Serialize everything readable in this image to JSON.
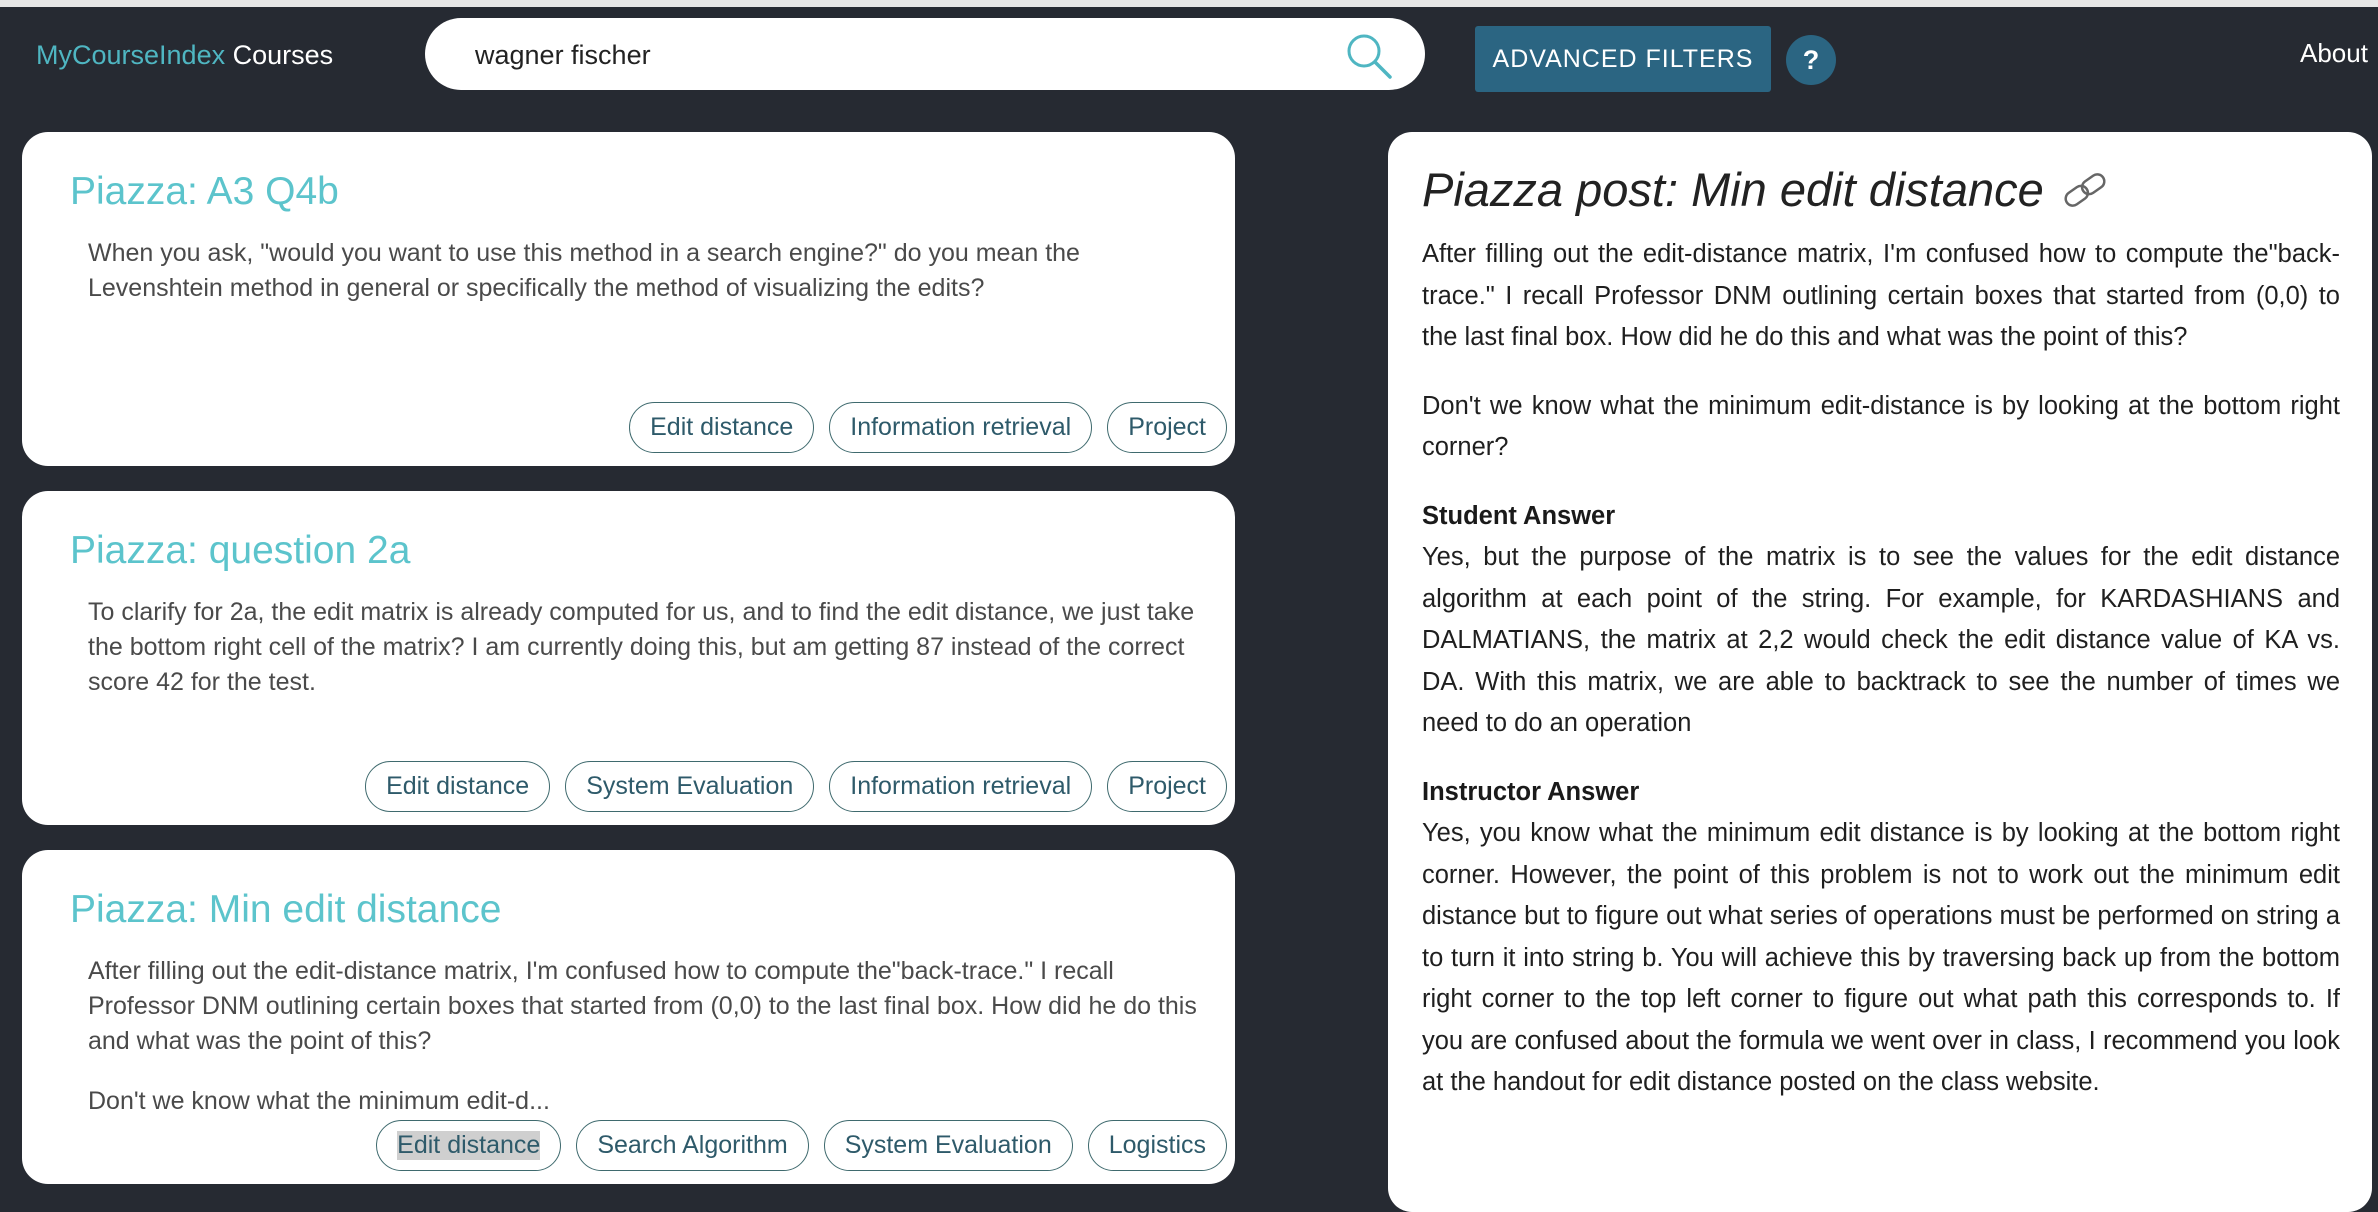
{
  "header": {
    "brand_left": "MyCourseIndex",
    "brand_right": "Courses",
    "search_value": "wagner fischer",
    "advanced_filters_label": "ADVANCED FILTERS",
    "help_label": "?",
    "about_label": "About"
  },
  "results": [
    {
      "title": "Piazza: A3 Q4b",
      "body": "When you ask, \"would you want to use this method in a search engine?\" do you mean the Levenshtein method in general or specifically the method of visualizing the edits?",
      "tags": [
        "Edit distance",
        "Information retrieval",
        "Project"
      ]
    },
    {
      "title": "Piazza: question 2a",
      "body": "To clarify for 2a, the edit matrix is already computed for us, and to find the edit distance, we just take the bottom right cell of the matrix? I am currently doing this, but am getting 87 instead of the correct score 42 for the test.",
      "tags": [
        "Edit distance",
        "System Evaluation",
        "Information retrieval",
        "Project"
      ]
    },
    {
      "title": "Piazza: Min edit distance",
      "body": "After filling out the edit-distance matrix, I'm confused how to compute the\"back-trace.\" I recall Professor DNM outlining certain boxes that started from (0,0) to the last final box. How did he do this and what was the point of this?",
      "body2": "Don't we know what the minimum edit-d...",
      "tags": [
        "Edit distance",
        "Search Algorithm",
        "System Evaluation",
        "Logistics"
      ]
    }
  ],
  "detail": {
    "title": "Piazza post: Min edit distance",
    "link_icon": "link-icon",
    "para1": "After filling out the edit-distance matrix, I'm confused how to compute the\"back-trace.\" I recall Professor DNM outlining certain boxes that started from (0,0) to the last final box. How did he do this and what was the point of this?",
    "para2": "Don't we know what the minimum edit-distance is by looking at the bottom right corner?",
    "student_label": "Student Answer",
    "student_answer": "Yes, but the purpose of the matrix is to see the values for the edit distance algorithm at each point of the string. For example, for KARDASHIANS and DALMATIANS, the matrix at 2,2 would check the edit distance value of KA vs. DA. With this matrix, we are able to backtrack to see the number of times we need to do an operation",
    "instructor_label": "Instructor Answer",
    "instructor_answer": "Yes, you know what the minimum edit distance is by looking at the bottom right corner. However, the point of this problem is not to work out the minimum edit distance but to figure out what series of operations must be performed on string a to turn it into string b. You will achieve this by traversing back up from the bottom right corner to the top left corner to figure out what path this corresponds to. If you are confused about the formula we went over in class, I recommend you look at the handout for edit distance posted on the class website."
  },
  "colors": {
    "background": "#262a32",
    "accent": "#5cc4cc",
    "button": "#2b6582"
  }
}
